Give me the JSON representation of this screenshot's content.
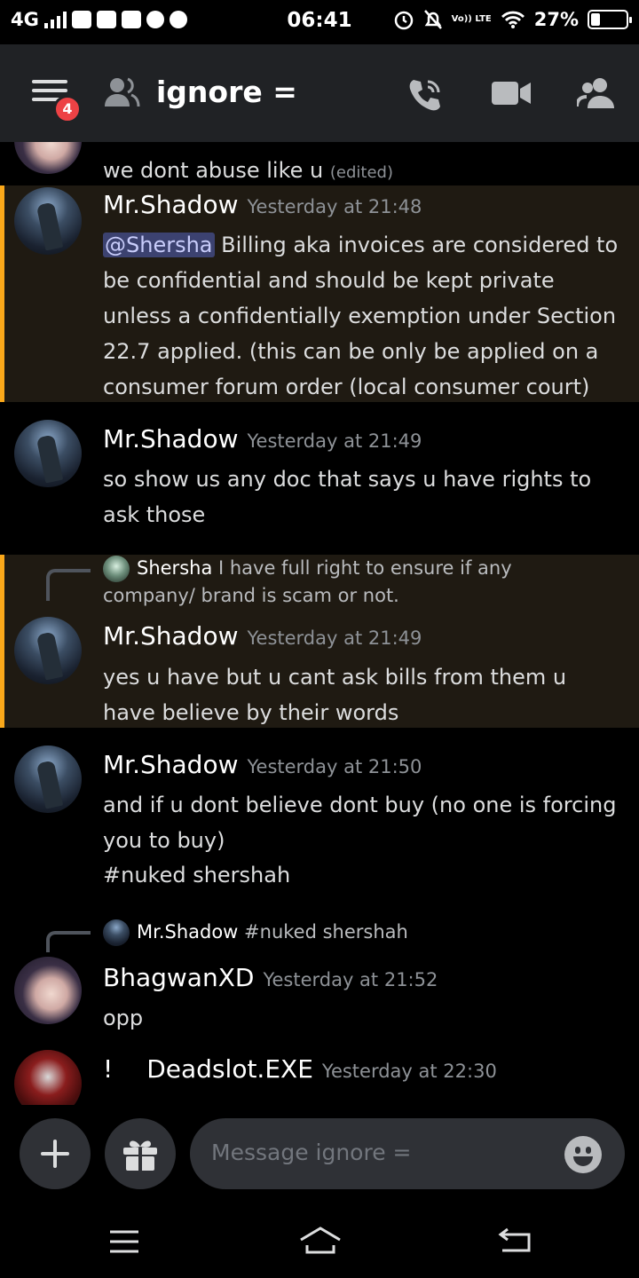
{
  "status_bar": {
    "network": "4G",
    "time": "06:41",
    "volte": "Vo)) LTE",
    "battery": "27%",
    "battery_level": 0.27
  },
  "header": {
    "notification_count": "4",
    "channel_name": "ignore ="
  },
  "messages": [
    {
      "body": "we dont abuse like u",
      "edited": "(edited)"
    },
    {
      "author": "Mr.Shadow",
      "timestamp": "Yesterday at 21:48",
      "mention": "@Shersha",
      "body": " Billing aka invoices are considered to be confidential and should be kept private unless a confidentially exemption under Section 22.7 applied. (this can be only be applied on a consumer forum order (local consumer court)"
    },
    {
      "author": "Mr.Shadow",
      "timestamp": "Yesterday at 21:49",
      "body": "so show us any doc that says u have rights to ask those"
    },
    {
      "reply_author": "Shersha",
      "reply_text": " I have full right to ensure if any company/ brand is scam or not.",
      "author": "Mr.Shadow",
      "timestamp": "Yesterday at 21:49",
      "body": "yes u have but u cant ask bills from them u have believe by their words"
    },
    {
      "author": "Mr.Shadow",
      "timestamp": "Yesterday at 21:50",
      "body": "and if u dont believe dont buy (no one is forcing you to buy)",
      "body2": "#nuked shershah"
    },
    {
      "reply_author": "Mr.Shadow",
      "reply_text": " #nuked shershah",
      "author": "BhagwanXD",
      "timestamp": "Yesterday at 21:52",
      "body": "opp"
    },
    {
      "prefix": "!",
      "author": "Deadslot.EXE",
      "timestamp": "Yesterday at 22:30"
    }
  ],
  "input": {
    "placeholder": "Message ignore ="
  },
  "icons": {
    "menu": "hamburger-icon",
    "members": "members-icon",
    "call": "phone-call-icon",
    "video": "video-camera-icon",
    "add": "plus-icon",
    "gift": "gift-icon",
    "emoji": "emoji-icon"
  },
  "colors": {
    "accent_mention": "#faa81a",
    "badge": "#ed4245",
    "header_bg": "#202225",
    "input_bg": "#2f3136"
  }
}
